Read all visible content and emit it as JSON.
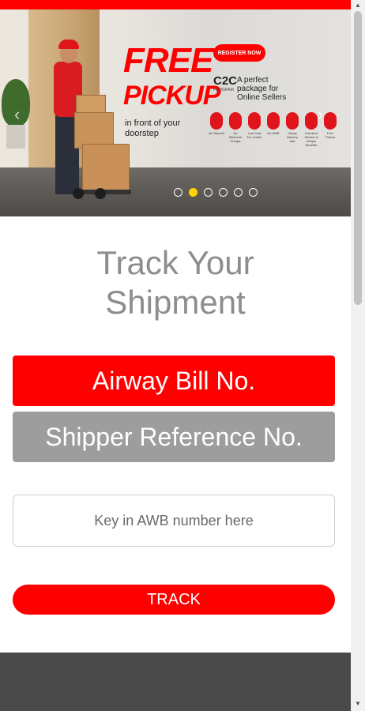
{
  "banner": {
    "headline_1": "FREE",
    "headline_2": "PICKUP",
    "subtext": "in front of your doorstep",
    "register_label": "REGISTER NOW",
    "c2c_label": "C2C",
    "c2c_sub": "PROGRAM",
    "package_text": "A perfect package for Online Sellers",
    "features": [
      "No Deposit",
      "No Minimum Charge",
      "Low Cost For Codes",
      "No AWB",
      "Cheap delivery rate",
      "Premium Service & Unique Benefits",
      "Free Pickup"
    ],
    "prev_arrow": "‹",
    "next_arrow": "›",
    "slides": 6,
    "active_slide": 2
  },
  "tracking": {
    "title_line1": "Track Your",
    "title_line2": "Shipment",
    "tab_awb": "Airway Bill No.",
    "tab_reference": "Shipper Reference No.",
    "input_placeholder": "Key in AWB number here",
    "input_value": "",
    "track_button": "TRACK"
  },
  "colors": {
    "accent": "#ff0000",
    "inactive_tab": "#9d9d9d",
    "title_gray": "#8d8d8d",
    "footer": "#4a4a4a",
    "active_dot": "#ffd400"
  },
  "scrollbar": {
    "up_arrow": "▲",
    "down_arrow": "▼"
  }
}
